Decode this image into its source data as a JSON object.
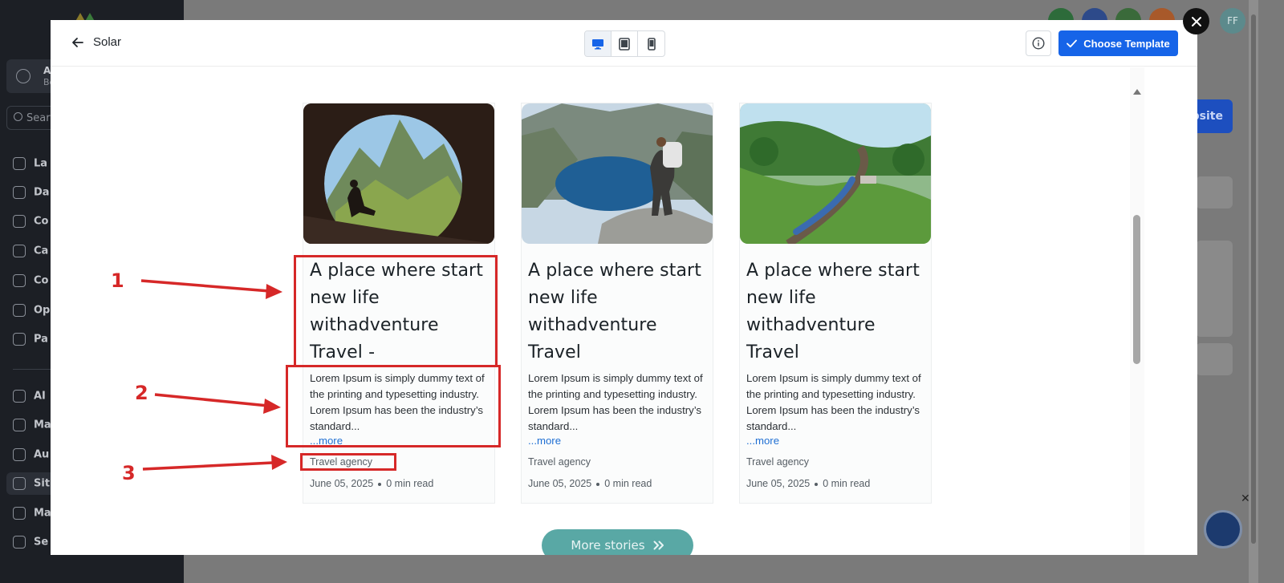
{
  "background": {
    "account": {
      "line1": "AI",
      "line2": "Be"
    },
    "search_placeholder": "Sear",
    "nav": [
      "La",
      "Da",
      "Co",
      "Ca",
      "Co",
      "Op",
      "Pa",
      "AI",
      "Ma",
      "Au",
      "Sit",
      "Ma",
      "Se"
    ],
    "avatar_initials": "FF",
    "website_button": "bsite"
  },
  "modal": {
    "title": "Solar",
    "choose_template_label": "Choose Template",
    "more_stories_label": "More stories"
  },
  "cards": [
    {
      "title": "A place where start new life withadventure Travel -",
      "description": "Lorem Ipsum is simply dummy text of the printing and typesetting industry. Lorem Ipsum has been the industry’s standard...",
      "more": "...more",
      "category": "Travel agency",
      "date": "June 05, 2025",
      "read_time": "0 min read"
    },
    {
      "title": "A place where start new life withadventure Travel",
      "description": "Lorem Ipsum is simply dummy text of the printing and typesetting industry. Lorem Ipsum has been the industry’s standard...",
      "more": "...more",
      "category": "Travel agency",
      "date": "June 05, 2025",
      "read_time": "0 min read"
    },
    {
      "title": "A place where start new life withadventure Travel",
      "description": "Lorem Ipsum is simply dummy text of the printing and typesetting industry. Lorem Ipsum has been the industry’s standard...",
      "more": "...more",
      "category": "Travel agency",
      "date": "June 05, 2025",
      "read_time": "0 min read"
    }
  ],
  "annotations": [
    "1",
    "2",
    "3"
  ],
  "colors": {
    "primary_blue": "#1664e8",
    "teal_button": "#59a8a5",
    "annotation_red": "#d62828",
    "link_blue": "#1f6fd3"
  },
  "icons": [
    "arrow-left-icon",
    "desktop-icon",
    "tablet-icon",
    "mobile-icon",
    "info-icon",
    "check-icon",
    "double-chevron-right-icon",
    "close-icon"
  ]
}
